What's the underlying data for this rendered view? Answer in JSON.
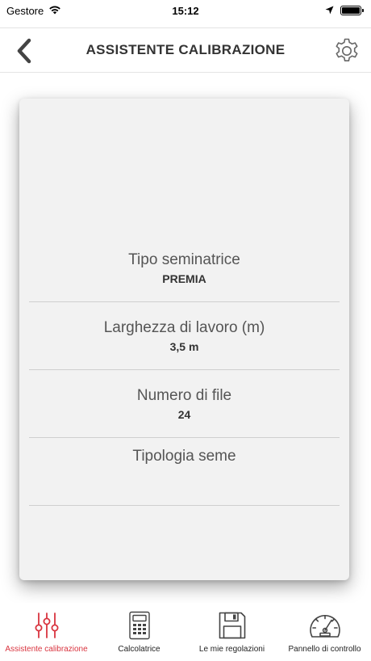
{
  "status_bar": {
    "carrier": "Gestore",
    "time": "15:12"
  },
  "header": {
    "title": "ASSISTENTE CALIBRAZIONE"
  },
  "fields": [
    {
      "label": "Tipo seminatrice",
      "value": "PREMIA"
    },
    {
      "label": "Larghezza di lavoro (m)",
      "value": "3,5 m"
    },
    {
      "label": "Numero di file",
      "value": "24"
    },
    {
      "label": "Tipologia seme",
      "value": ""
    }
  ],
  "tabs": [
    {
      "label": "Assistente calibrazione",
      "icon": "sliders-icon",
      "active": true
    },
    {
      "label": "Calcolatrice",
      "icon": "calculator-icon",
      "active": false
    },
    {
      "label": "Le mie regolazioni",
      "icon": "floppy-disk-icon",
      "active": false
    },
    {
      "label": "Pannello di controllo",
      "icon": "speedometer-icon",
      "active": false
    }
  ],
  "colors": {
    "accent": "#d9343f",
    "card_background": "#f2f2f2",
    "icon_gray": "#555555"
  }
}
